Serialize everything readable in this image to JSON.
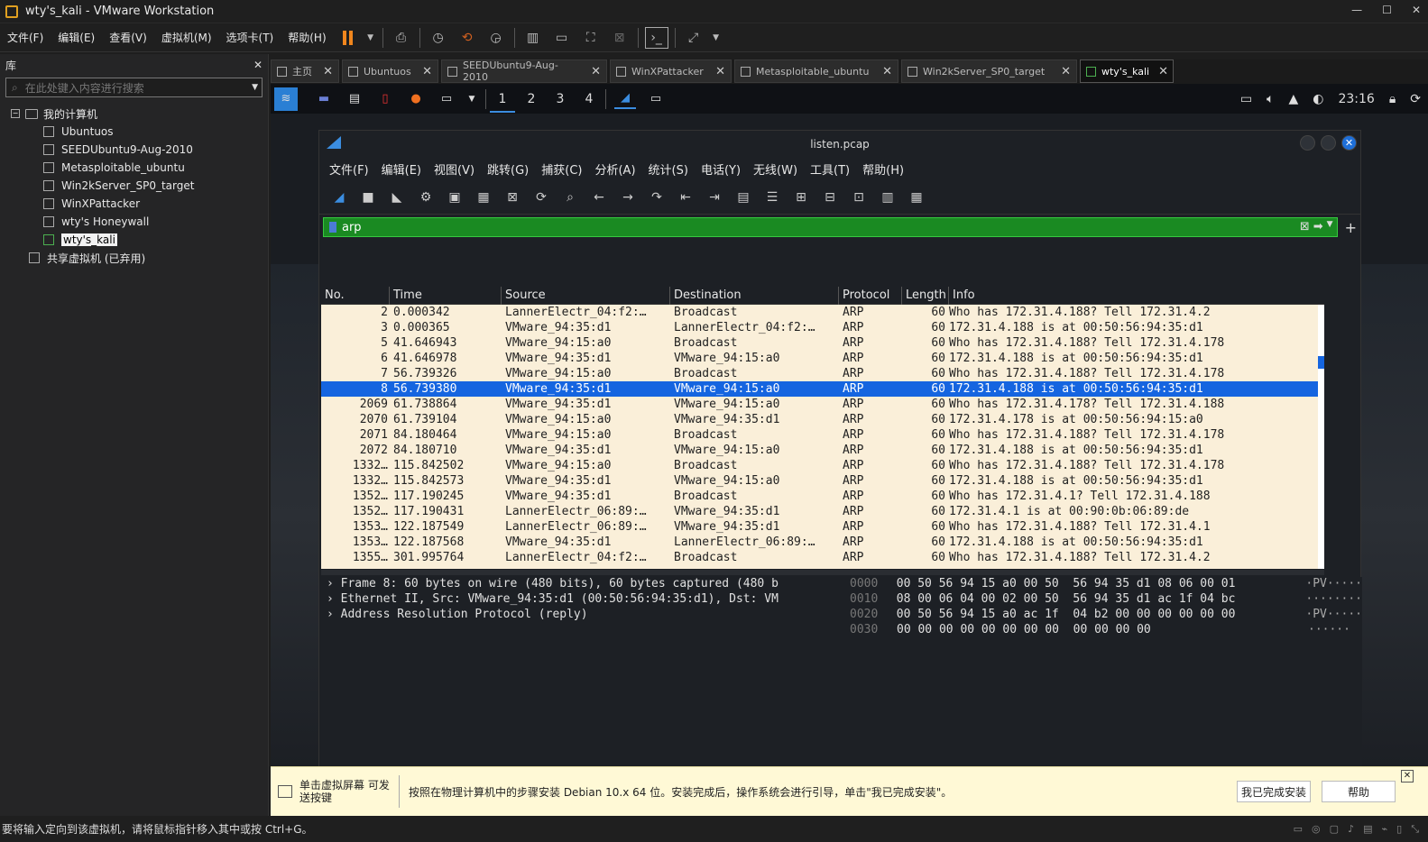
{
  "window": {
    "title": "wty's_kali - VMware Workstation"
  },
  "menu": [
    "文件(F)",
    "编辑(E)",
    "查看(V)",
    "虚拟机(M)",
    "选项卡(T)",
    "帮助(H)"
  ],
  "library": {
    "title": "库",
    "search_placeholder": "在此处键入内容进行搜索",
    "root": "我的计算机",
    "vms": [
      "Ubuntuos",
      "SEEDUbuntu9-Aug-2010",
      "Metasploitable_ubuntu",
      "Win2kServer_SP0_target",
      "WinXPattacker",
      "wty's Honeywall",
      "wty's_kali"
    ],
    "shared": "共享虚拟机 (已弃用)"
  },
  "tabs": [
    {
      "label": "主页",
      "active": false
    },
    {
      "label": "Ubuntuos",
      "active": false
    },
    {
      "label": "SEEDUbuntu9-Aug-2010",
      "active": false
    },
    {
      "label": "WinXPattacker",
      "active": false
    },
    {
      "label": "Metasploitable_ubuntu",
      "active": false
    },
    {
      "label": "Win2kServer_SP0_target",
      "active": false
    },
    {
      "label": "wty's_kali",
      "active": true
    }
  ],
  "kali_panel": {
    "workspaces": [
      "1",
      "2",
      "3",
      "4"
    ],
    "active_workspace": "1",
    "clock": "23:16"
  },
  "wireshark": {
    "title": "listen.pcap",
    "menu": [
      "文件(F)",
      "编辑(E)",
      "视图(V)",
      "跳转(G)",
      "捕获(C)",
      "分析(A)",
      "统计(S)",
      "电话(Y)",
      "无线(W)",
      "工具(T)",
      "帮助(H)"
    ],
    "filter": "arp",
    "columns": [
      "No.",
      "Time",
      "Source",
      "Destination",
      "Protocol",
      "Length",
      "Info"
    ],
    "packets": [
      {
        "no": "2",
        "time": "0.000342",
        "src": "LannerElectr_04:f2:…",
        "dst": "Broadcast",
        "proto": "ARP",
        "len": "60",
        "info": "Who has 172.31.4.188? Tell 172.31.4.2",
        "selected": false
      },
      {
        "no": "3",
        "time": "0.000365",
        "src": "VMware_94:35:d1",
        "dst": "LannerElectr_04:f2:…",
        "proto": "ARP",
        "len": "60",
        "info": "172.31.4.188 is at 00:50:56:94:35:d1",
        "selected": false
      },
      {
        "no": "5",
        "time": "41.646943",
        "src": "VMware_94:15:a0",
        "dst": "Broadcast",
        "proto": "ARP",
        "len": "60",
        "info": "Who has 172.31.4.188? Tell 172.31.4.178",
        "selected": false
      },
      {
        "no": "6",
        "time": "41.646978",
        "src": "VMware_94:35:d1",
        "dst": "VMware_94:15:a0",
        "proto": "ARP",
        "len": "60",
        "info": "172.31.4.188 is at 00:50:56:94:35:d1",
        "selected": false
      },
      {
        "no": "7",
        "time": "56.739326",
        "src": "VMware_94:15:a0",
        "dst": "Broadcast",
        "proto": "ARP",
        "len": "60",
        "info": "Who has 172.31.4.188? Tell 172.31.4.178",
        "selected": false
      },
      {
        "no": "8",
        "time": "56.739380",
        "src": "VMware_94:35:d1",
        "dst": "VMware_94:15:a0",
        "proto": "ARP",
        "len": "60",
        "info": "172.31.4.188 is at 00:50:56:94:35:d1",
        "selected": true
      },
      {
        "no": "2069",
        "time": "61.738864",
        "src": "VMware_94:35:d1",
        "dst": "VMware_94:15:a0",
        "proto": "ARP",
        "len": "60",
        "info": "Who has 172.31.4.178? Tell 172.31.4.188",
        "selected": false
      },
      {
        "no": "2070",
        "time": "61.739104",
        "src": "VMware_94:15:a0",
        "dst": "VMware_94:35:d1",
        "proto": "ARP",
        "len": "60",
        "info": "172.31.4.178 is at 00:50:56:94:15:a0",
        "selected": false
      },
      {
        "no": "2071",
        "time": "84.180464",
        "src": "VMware_94:15:a0",
        "dst": "Broadcast",
        "proto": "ARP",
        "len": "60",
        "info": "Who has 172.31.4.188? Tell 172.31.4.178",
        "selected": false
      },
      {
        "no": "2072",
        "time": "84.180710",
        "src": "VMware_94:35:d1",
        "dst": "VMware_94:15:a0",
        "proto": "ARP",
        "len": "60",
        "info": "172.31.4.188 is at 00:50:56:94:35:d1",
        "selected": false
      },
      {
        "no": "1332…",
        "time": "115.842502",
        "src": "VMware_94:15:a0",
        "dst": "Broadcast",
        "proto": "ARP",
        "len": "60",
        "info": "Who has 172.31.4.188? Tell 172.31.4.178",
        "selected": false
      },
      {
        "no": "1332…",
        "time": "115.842573",
        "src": "VMware_94:35:d1",
        "dst": "VMware_94:15:a0",
        "proto": "ARP",
        "len": "60",
        "info": "172.31.4.188 is at 00:50:56:94:35:d1",
        "selected": false
      },
      {
        "no": "1352…",
        "time": "117.190245",
        "src": "VMware_94:35:d1",
        "dst": "Broadcast",
        "proto": "ARP",
        "len": "60",
        "info": "Who has 172.31.4.1? Tell 172.31.4.188",
        "selected": false
      },
      {
        "no": "1352…",
        "time": "117.190431",
        "src": "LannerElectr_06:89:…",
        "dst": "VMware_94:35:d1",
        "proto": "ARP",
        "len": "60",
        "info": "172.31.4.1 is at 00:90:0b:06:89:de",
        "selected": false
      },
      {
        "no": "1353…",
        "time": "122.187549",
        "src": "LannerElectr_06:89:…",
        "dst": "VMware_94:35:d1",
        "proto": "ARP",
        "len": "60",
        "info": "Who has 172.31.4.188? Tell 172.31.4.1",
        "selected": false
      },
      {
        "no": "1353…",
        "time": "122.187568",
        "src": "VMware_94:35:d1",
        "dst": "LannerElectr_06:89:…",
        "proto": "ARP",
        "len": "60",
        "info": "172.31.4.188 is at 00:50:56:94:35:d1",
        "selected": false
      },
      {
        "no": "1355…",
        "time": "301.995764",
        "src": "LannerElectr_04:f2:…",
        "dst": "Broadcast",
        "proto": "ARP",
        "len": "60",
        "info": "Who has 172.31.4.188? Tell 172.31.4.2",
        "selected": false
      }
    ],
    "details": [
      "Frame 8: 60 bytes on wire (480 bits), 60 bytes captured (480 b",
      "Ethernet II, Src: VMware_94:35:d1 (00:50:56:94:35:d1), Dst: VM",
      "Address Resolution Protocol (reply)"
    ],
    "hex": [
      {
        "offset": "0000",
        "bytes": "00 50 56 94 15 a0 00 50  56 94 35 d1 08 06 00 01",
        "ascii": "·PV·····"
      },
      {
        "offset": "0010",
        "bytes": "08 00 06 04 00 02 00 50  56 94 35 d1 ac 1f 04 bc",
        "ascii": "········"
      },
      {
        "offset": "0020",
        "bytes": "00 50 56 94 15 a0 ac 1f  04 b2 00 00 00 00 00 00",
        "ascii": "·PV·····"
      },
      {
        "offset": "0030",
        "bytes": "00 00 00 00 00 00 00 00  00 00 00 00",
        "ascii": "······"
      }
    ]
  },
  "notification": {
    "short": "单击虚拟屏幕 可发送按键",
    "message": "按照在物理计算机中的步骤安装 Debian 10.x 64 位。安装完成后，操作系统会进行引导，单击\"我已完成安装\"。",
    "done_button": "我已完成安装",
    "help_button": "帮助"
  },
  "statusbar": {
    "text": "要将输入定向到该虚拟机，请将鼠标指针移入其中或按 Ctrl+G。"
  },
  "colors": {
    "filter_bg": "#1a8a22",
    "selected_row": "#1565e0",
    "row_bg": "#faefd9",
    "accent": "#f0861d"
  }
}
